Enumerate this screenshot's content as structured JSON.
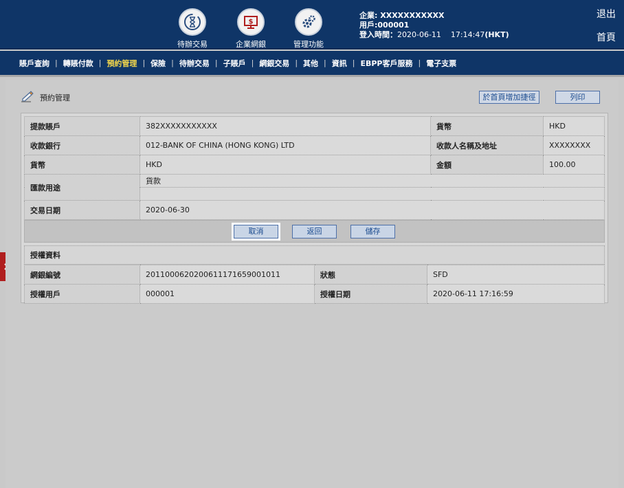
{
  "header": {
    "icons": [
      {
        "label": "待辦交易",
        "icon": "hourglass-refresh-icon"
      },
      {
        "label": "企業網銀",
        "icon": "monitor-dollar-icon"
      },
      {
        "label": "管理功能",
        "icon": "gears-icon"
      }
    ],
    "company": "企業: XXXXXXXXXXX",
    "user": "用戶:000001",
    "login_label": "登入時間：",
    "login_time": "2020-06-11    17:14:47",
    "login_tz": "(HKT)",
    "logout": "退出",
    "home": "首頁"
  },
  "nav": [
    "賬戶查詢",
    "轉賬付款",
    "預約管理",
    "保險",
    "待辦交易",
    "子賬戶",
    "網銀交易",
    "其他",
    "資訊",
    "EBPP客戶服務",
    "電子支票"
  ],
  "nav_active": "預約管理",
  "page": {
    "title": "預約管理",
    "add_shortcut": "於首頁增加捷徑",
    "print": "列印"
  },
  "detail": {
    "debit_account_label": "提款賬戶",
    "debit_account": "382XXXXXXXXXXX",
    "currency1_label": "貨幣",
    "currency1": "HKD",
    "bank_label": "收款銀行",
    "bank": "012-BANK OF CHINA (HONG KONG) LTD",
    "payee_label": "收款人名稱及地址",
    "payee": "XXXXXXXX",
    "currency2_label": "貨幣",
    "currency2": "HKD",
    "amount_label": "金額",
    "amount": "100.00",
    "purpose_label": "匯款用途",
    "purpose": "貨款",
    "date_label": "交易日期",
    "date": "2020-06-30"
  },
  "actions": {
    "cancel": "取消",
    "back": "返回",
    "save": "儲存"
  },
  "auth": {
    "section_title": "授權資料",
    "ref_label": "網銀編號",
    "ref": "20110006202006111716590010​11",
    "status_label": "狀態",
    "status": "SFD",
    "user_label": "授權用戶",
    "user": "000001",
    "auth_date_label": "授權日期",
    "auth_date": "2020-06-11 17:16:59"
  },
  "colors": {
    "header_bg": "#0f3567",
    "nav_active": "#f1d54b",
    "side_tab": "#b01e1e"
  }
}
